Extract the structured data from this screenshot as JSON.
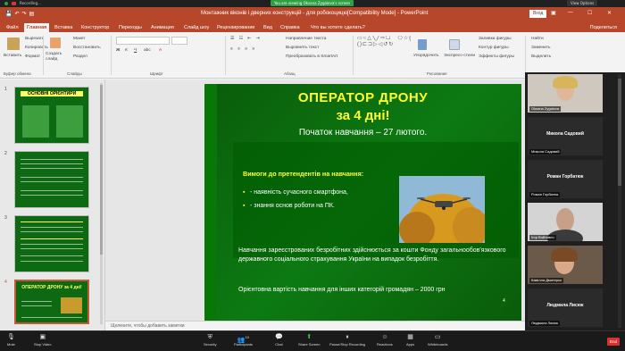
{
  "zoom": {
    "recording_label": "Recording...",
    "share_banner": "You are viewing Oksana Zygalova's screen",
    "view_options": "View Options",
    "toolbar": [
      {
        "label": "Mute",
        "icon": "microphone-icon"
      },
      {
        "label": "Stop Video",
        "icon": "video-camera-icon"
      },
      {
        "label": "Security",
        "icon": "shield-icon"
      },
      {
        "label": "Participants",
        "icon": "participants-icon",
        "count": "10"
      },
      {
        "label": "Chat",
        "icon": "chat-icon"
      },
      {
        "label": "Share Screen",
        "icon": "share-screen-icon"
      },
      {
        "label": "Pause/Stop Recording",
        "icon": "record-icon"
      },
      {
        "label": "Reactions",
        "icon": "smiley-icon"
      },
      {
        "label": "Apps",
        "icon": "apps-icon"
      },
      {
        "label": "Whiteboards",
        "icon": "whiteboard-icon"
      }
    ],
    "end_label": "End",
    "participants": [
      {
        "tag": "Oksana Zygalova",
        "center_name": "",
        "has_video": true
      },
      {
        "tag": "Микола Садовий",
        "center_name": "Микола Садовий",
        "has_video": false
      },
      {
        "tag": "Роман Горбатюк",
        "center_name": "Роман Горбатюк",
        "has_video": false
      },
      {
        "tag": "Ігор Войтович",
        "center_name": "",
        "has_video": true
      },
      {
        "tag": "Камілла Дмитерко",
        "center_name": "",
        "has_video": true
      },
      {
        "tag": "Людмила Лисюк",
        "center_name": "Людмила Лисюк",
        "has_video": false
      }
    ]
  },
  "ppt": {
    "title": "Монтажник віконів і дверних конструкцій - для робокоцицю[Compatibility Mode] - PowerPoint",
    "login": "Вход",
    "share": "Поделиться",
    "tabs": [
      "Файл",
      "Главная",
      "Вставка",
      "Конструктор",
      "Переходы",
      "Анимация",
      "Слайд шоу",
      "Рецензирование",
      "Вид",
      "Справка",
      "Что вы хотите сделать?"
    ],
    "ribbon": {
      "paste": "Вставить",
      "cut": "Вырезать",
      "copy": "Копировать",
      "format": "Формат",
      "new_slide": "Создать слайд",
      "layout": "Макет",
      "reset": "Восстановить",
      "section": "Раздел",
      "text_direction": "Направление текста",
      "align_text": "Выровнять текст",
      "smartart": "Преобразовать в SmartArt",
      "arrange": "Упорядочить",
      "quick_styles": "Экспресс-стили",
      "shape_fill": "Заливка фигуры",
      "shape_outline": "Контур фигуры",
      "shape_effects": "Эффекты фигуры",
      "find": "Найти",
      "replace": "Заменить",
      "select": "Выделить",
      "groups": [
        "Буфер обмена",
        "Слайды",
        "Шрифт",
        "Абзац",
        "Рисование",
        "Редактирование"
      ]
    },
    "notes_placeholder": "Щелкните, чтобы добавить заметки",
    "thumbnails": [
      {
        "num": "1",
        "title": "ОСНОВНІ ОРІЄНТИРИ"
      },
      {
        "num": "2",
        "title": ""
      },
      {
        "num": "3",
        "title": ""
      },
      {
        "num": "4",
        "title": "ОПЕРАТОР ДРОНУ за 4 дні!"
      }
    ],
    "slide": {
      "title_line1": "ОПЕРАТОР ДРОНУ",
      "title_line2": "за 4 дні!",
      "subtitle": "Початок навчання – 27 лютого.",
      "requirements_heading": "Вимоги до претендентів на навчання:",
      "requirements": [
        "- наявність сучасного смартфона,",
        "- знання основ роботи на ПК."
      ],
      "funding_text": "Навчання зареєстрованих безробітних здійснюється за кошти Фонду загальнообов'язкового державного соціального страхування України на випадок безробіття.",
      "price_text": "Орієнтовна вартість навчання для інших категорій громадян – 2000 грн",
      "page_number": "4"
    }
  }
}
